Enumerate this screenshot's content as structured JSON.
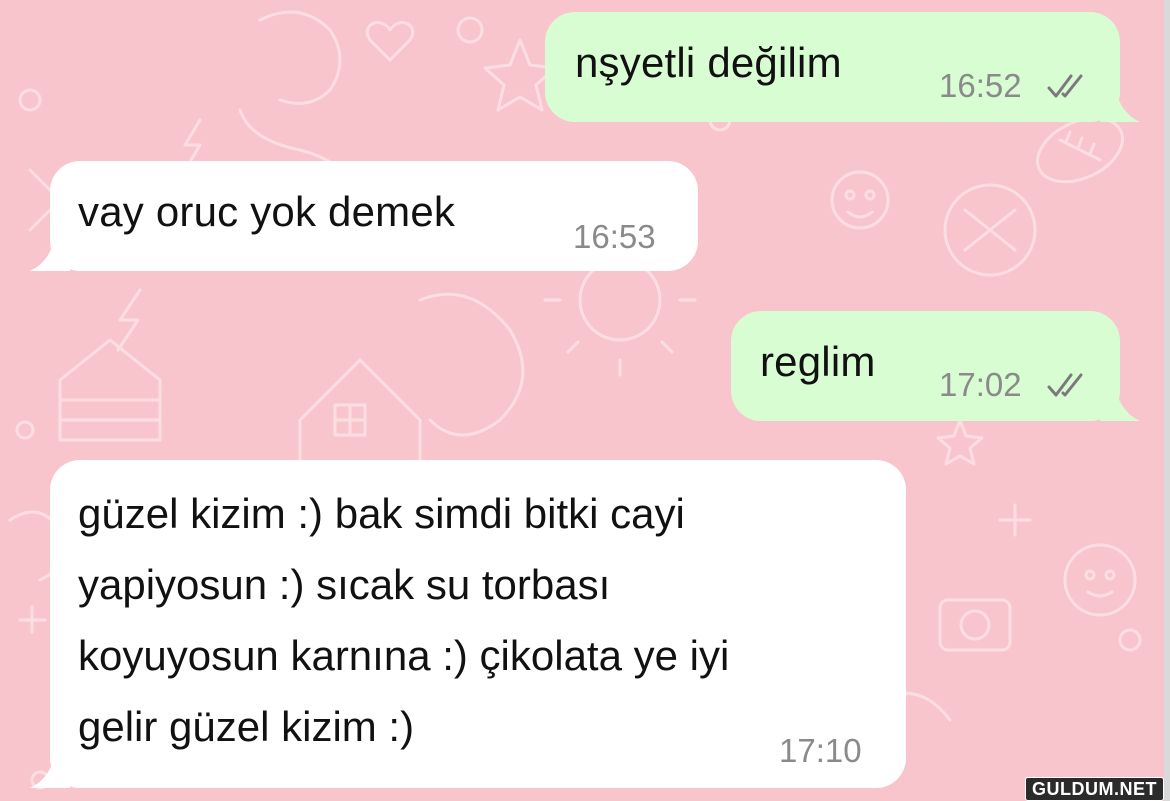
{
  "conversation": {
    "messages": [
      {
        "direction": "outgoing",
        "text": "nşyetli değilim",
        "time": "16:52",
        "status_icon": "double-check-icon"
      },
      {
        "direction": "incoming",
        "text": "vay oruc yok demek",
        "time": "16:53"
      },
      {
        "direction": "outgoing",
        "text": "reglim",
        "time": "17:02",
        "status_icon": "double-check-icon"
      },
      {
        "direction": "incoming",
        "text": "güzel kizim :) bak simdi bitki cayi\nyapiyosun :) sıcak su torbası\nkoyuyosun karnına :) çikolata ye iyi\ngelir güzel kizim :)",
        "time": "17:10"
      }
    ]
  },
  "watermark": "GULDUM.NET",
  "colors": {
    "wallpaper": "#f8c5cc",
    "outgoing_bubble": "#d9fdd3",
    "incoming_bubble": "#ffffff",
    "tick_color": "#7a7a7a"
  }
}
